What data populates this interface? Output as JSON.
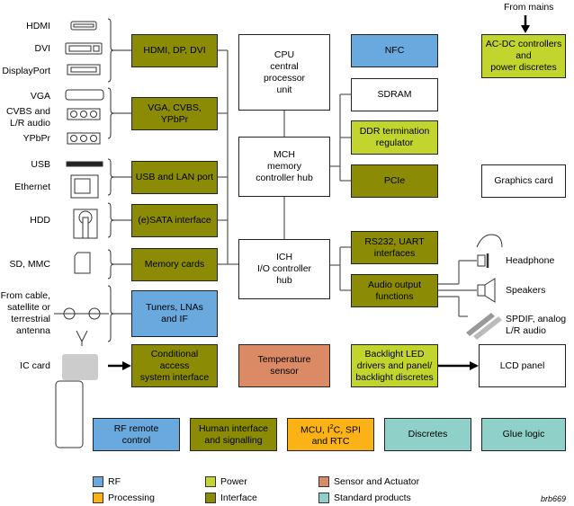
{
  "colors": {
    "rf": "#6aa9dd",
    "power": "#c2d52e",
    "interface": "#8b8b05",
    "processing": "#fbb217",
    "sensor": "#db8a66",
    "standard": "#8fd1c9"
  },
  "left_labels": {
    "hdmi": "HDMI",
    "dvi": "DVI",
    "displayport": "DisplayPort",
    "vga": "VGA",
    "cvbs": "CVBS and\nL/R audio",
    "ypbpr": "YPbPr",
    "usb": "USB",
    "ethernet": "Ethernet",
    "hdd": "HDD",
    "sd": "SD, MMC",
    "antenna": "From cable,\nsatellite or\nterrestrial\nantenna",
    "ic_card": "IC card"
  },
  "blocks": {
    "hdmi_dp_dvi": "HDMI, DP, DVI",
    "vga_cvbs": "VGA, CVBS,\nYPbPr",
    "usb_lan": "USB and LAN port",
    "esata": "(e)SATA interface",
    "memory_cards": "Memory cards",
    "tuners": "Tuners, LNAs\nand IF",
    "conditional_access": "Conditional\naccess\nsystem interface",
    "cpu": "CPU\ncentral\nprocessor\nunit",
    "mch": "MCH\nmemory\ncontroller hub",
    "ich": "ICH\nI/O controller\nhub",
    "nfc": "NFC",
    "sdram": "SDRAM",
    "ddr_term": "DDR termination\nregulator",
    "pcie": "PCIe",
    "rs232": "RS232, UART\ninterfaces",
    "audio_out": "Audio output\nfunctions",
    "temperature": "Temperature\nsensor",
    "backlight": "Backlight LED\ndrivers and panel/\nbacklight discretes",
    "lcd": "LCD panel",
    "acdc": "AC-DC controllers\nand\npower discretes",
    "graphics": "Graphics card",
    "rf_remote": "RF remote\ncontrol",
    "human_iface": "Human interface\nand signalling",
    "mcu_pre": "MCU, I",
    "mcu_sup": "2",
    "mcu_post": "C, SPI\nand RTC",
    "discretes": "Discretes",
    "glue": "Glue logic"
  },
  "right_labels": {
    "from_mains": "From mains",
    "headphone": "Headphone",
    "speakers": "Speakers",
    "spdif": "SPDIF, analog\nL/R audio"
  },
  "legend": [
    {
      "label": "RF",
      "color": "#6aa9dd"
    },
    {
      "label": "Processing",
      "color": "#fbb217"
    },
    {
      "label": "Power",
      "color": "#c2d52e"
    },
    {
      "label": "Interface",
      "color": "#8b8b05"
    },
    {
      "label": "Sensor and Actuator",
      "color": "#db8a66"
    },
    {
      "label": "Standard products",
      "color": "#8fd1c9"
    }
  ],
  "ref": "brb669"
}
